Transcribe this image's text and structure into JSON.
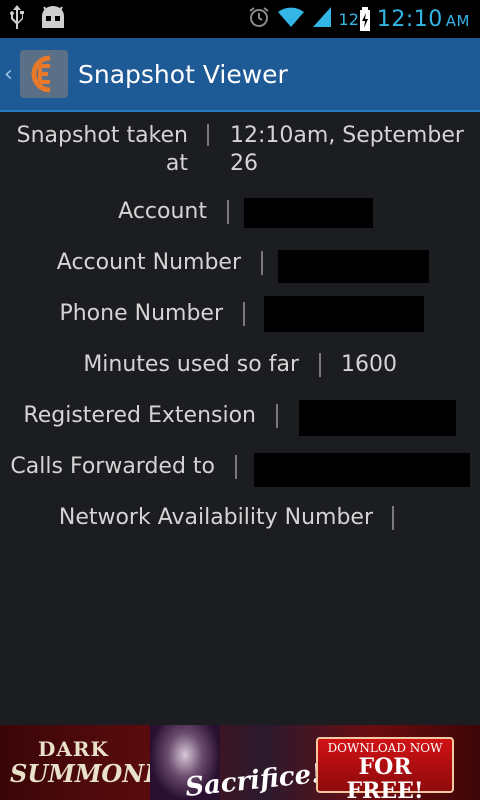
{
  "status_bar": {
    "left_icons": [
      "usb-icon",
      "android-debug-icon"
    ],
    "right_icons": [
      "alarm-icon",
      "wifi-icon",
      "signal-icon"
    ],
    "battery_level": "12",
    "time": "12:10",
    "ampm": "AM"
  },
  "action_bar": {
    "title": "Snapshot Viewer"
  },
  "details": [
    {
      "label": "Snapshot taken at",
      "value": "12:10am, September 26",
      "redacted": false
    },
    {
      "label": "Account",
      "value": "",
      "redacted": true
    },
    {
      "label": "Account Number",
      "value": "",
      "redacted": true
    },
    {
      "label": "Phone Number",
      "value": "",
      "redacted": true
    },
    {
      "label": "Minutes used so far",
      "value": "1600",
      "redacted": false
    },
    {
      "label": "Registered Extension",
      "value": "",
      "redacted": true
    },
    {
      "label": "Calls Forwarded to",
      "value": "",
      "redacted": true
    },
    {
      "label": "Network Availability Number",
      "value": "",
      "redacted": false
    }
  ],
  "ad_banner": {
    "brand_line1": "DARK",
    "brand_line2": "SUMMONER",
    "tagline": "Sacrifice!?",
    "cta_line1": "DOWNLOAD NOW",
    "cta_line2": "FOR FREE!"
  },
  "colors": {
    "accent": "#33b5e5",
    "action_bar": "#1e5a96",
    "background": "#1c1d20"
  }
}
